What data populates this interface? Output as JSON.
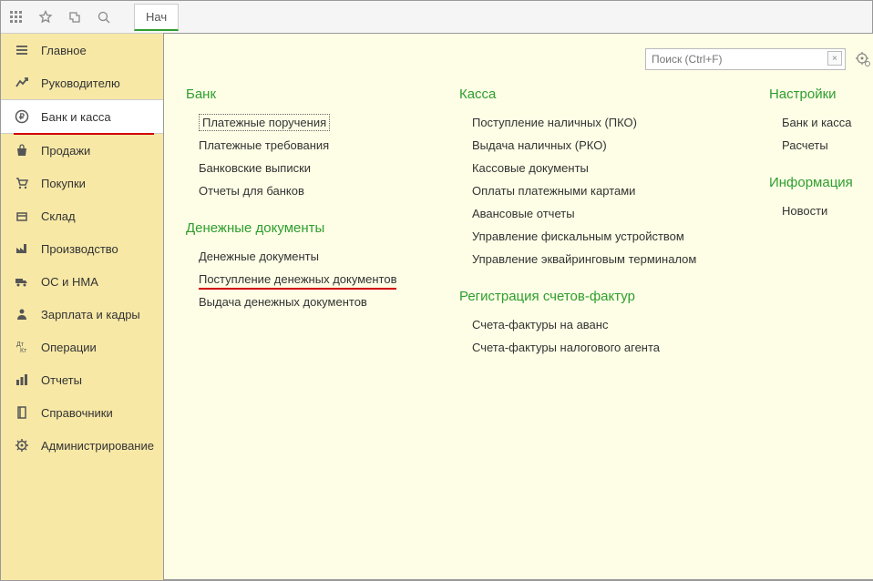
{
  "toolbar": {
    "tab_start": "Нач"
  },
  "sidebar": [
    {
      "label": "Главное",
      "icon": "menu-icon"
    },
    {
      "label": "Руководителю",
      "icon": "chart-icon"
    },
    {
      "label": "Банк и касса",
      "icon": "ruble-icon",
      "active": true
    },
    {
      "label": "Продажи",
      "icon": "bag-icon"
    },
    {
      "label": "Покупки",
      "icon": "cart-icon"
    },
    {
      "label": "Склад",
      "icon": "box-icon"
    },
    {
      "label": "Производство",
      "icon": "factory-icon"
    },
    {
      "label": "ОС и НМА",
      "icon": "truck-icon"
    },
    {
      "label": "Зарплата и кадры",
      "icon": "person-icon"
    },
    {
      "label": "Операции",
      "icon": "transactions-icon"
    },
    {
      "label": "Отчеты",
      "icon": "bars-icon"
    },
    {
      "label": "Справочники",
      "icon": "book-icon"
    },
    {
      "label": "Администрирование",
      "icon": "gear-icon"
    }
  ],
  "search": {
    "placeholder": "Поиск (Ctrl+F)"
  },
  "columns": [
    {
      "sections": [
        {
          "title": "Банк",
          "links": [
            {
              "label": "Платежные поручения",
              "dotted": true
            },
            {
              "label": "Платежные требования"
            },
            {
              "label": "Банковские выписки"
            },
            {
              "label": "Отчеты для банков"
            }
          ]
        },
        {
          "title": "Денежные документы",
          "links": [
            {
              "label": "Денежные документы"
            },
            {
              "label": "Поступление денежных документов",
              "underlined": true
            },
            {
              "label": "Выдача денежных документов"
            }
          ]
        }
      ]
    },
    {
      "sections": [
        {
          "title": "Касса",
          "links": [
            {
              "label": "Поступление наличных (ПКО)"
            },
            {
              "label": "Выдача наличных (РКО)"
            },
            {
              "label": "Кассовые документы"
            },
            {
              "label": "Оплаты платежными картами"
            },
            {
              "label": "Авансовые отчеты"
            },
            {
              "label": "Управление фискальным устройством"
            },
            {
              "label": "Управление эквайринговым терминалом"
            }
          ]
        },
        {
          "title": "Регистрация счетов-фактур",
          "links": [
            {
              "label": "Счета-фактуры на аванс"
            },
            {
              "label": "Счета-фактуры налогового агента"
            }
          ]
        }
      ]
    },
    {
      "sections": [
        {
          "title": "Настройки",
          "links": [
            {
              "label": "Банк и касса"
            },
            {
              "label": "Расчеты"
            }
          ]
        },
        {
          "title": "Информация",
          "links": [
            {
              "label": "Новости"
            }
          ]
        }
      ]
    }
  ]
}
